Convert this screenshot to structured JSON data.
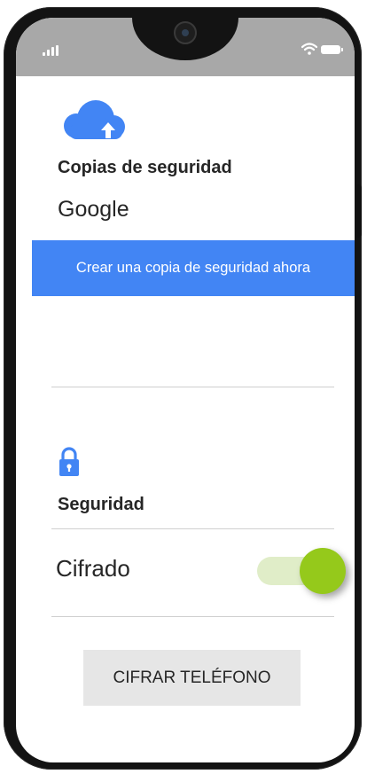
{
  "status_bar": {
    "icons": [
      "signal-icon",
      "camera-icon",
      "wifi-icon",
      "battery-icon"
    ]
  },
  "backup": {
    "icon": "cloud-upload-icon",
    "icon_color": "#4285f4",
    "title": "Copias de seguridad",
    "account": "Google",
    "button_label": "Crear una copia de seguridad ahora",
    "button_color": "#4285f4"
  },
  "security": {
    "icon": "lock-icon",
    "icon_color": "#4285f4",
    "title": "Seguridad",
    "encryption_label": "Cifrado",
    "encryption_enabled": true,
    "toggle_color": "#95c91b",
    "toggle_track_color": "#e0edc8",
    "encrypt_button_label": "CIFRAR TELÉFONO"
  }
}
